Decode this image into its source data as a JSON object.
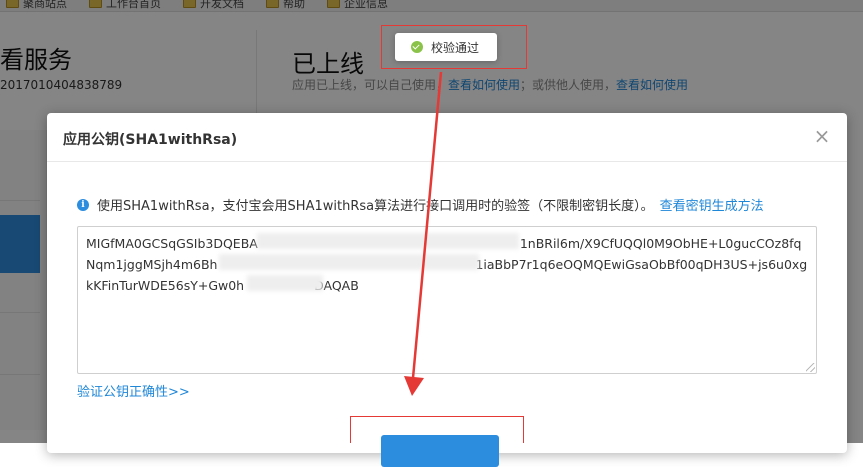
{
  "bookmarks": [
    "聚商站点",
    "工作台首页",
    "开发文档",
    "帮助",
    "企业信息"
  ],
  "background": {
    "title_left": "看服务",
    "app_id": "2017010404838789",
    "title_right": "已上线",
    "subtitle_prefix": "应用已上线，可以自己使用，",
    "subtitle_link1": "查看如何使用",
    "subtitle_mid": "；或供他人使用，",
    "subtitle_link2": "查看如何使用"
  },
  "toast": {
    "text": "校验通过"
  },
  "modal": {
    "title": "应用公钥(SHA1withRsa)",
    "close_glyph": "×",
    "info_text": "使用SHA1withRsa，支付宝会用SHA1withRsa算法进行接口调用时的验签（不限制密钥长度）。",
    "info_link": "查看密钥生成方法",
    "key_value": "MIGfMA0GCSqGSIb3DQEBA",
    "key_line1_tail": "1nBRil6m/X9CfUQQl0M9ObHE+L0gucCOz8fq",
    "key_line2_head": "Nqm1jggMSjh4m6Bh",
    "key_line2_tail": "1iaBbP7r1q6eOQMQEwiGsaObBf00qDH3US+js6u0xg",
    "key_line3_head": "kKFinTurWDE56sY+Gw0h",
    "key_line3_tail": "DAQAB",
    "verify_link": "验证公钥正确性>>"
  },
  "colors": {
    "accent": "#2c8ddf",
    "annotation": "#e53935",
    "success": "#8bc34a"
  }
}
